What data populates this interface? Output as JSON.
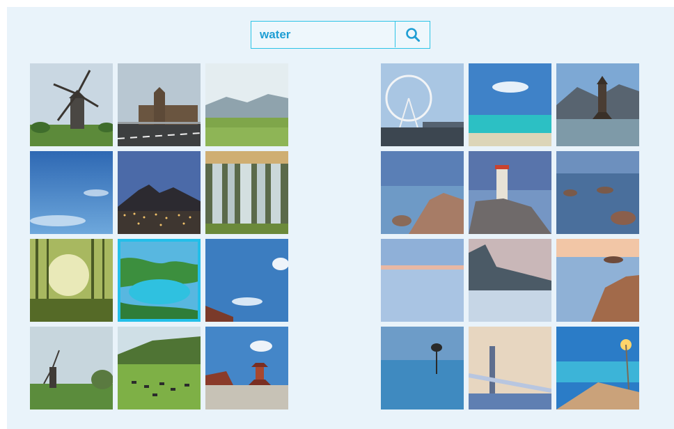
{
  "search": {
    "value": "water",
    "icon": "search-icon",
    "accent_color": "#2cc4e6",
    "text_color": "#1f9ed4"
  },
  "left_gallery": {
    "selected_index": 7,
    "tiles": [
      {
        "icon": "windmill-photo"
      },
      {
        "icon": "parliament-building-photo"
      },
      {
        "icon": "mountain-meadow-photo"
      },
      {
        "icon": "blue-sky-photo"
      },
      {
        "icon": "night-city-mountain-photo"
      },
      {
        "icon": "waterfall-photo"
      },
      {
        "icon": "sunlit-forest-photo"
      },
      {
        "icon": "tropical-lagoon-photo"
      },
      {
        "icon": "sky-with-rooftop-photo"
      },
      {
        "icon": "windmill-field-photo"
      },
      {
        "icon": "grazing-cows-hills-photo"
      },
      {
        "icon": "pagoda-temple-photo"
      }
    ]
  },
  "right_gallery": {
    "tiles": [
      {
        "icon": "ferris-wheel-photo"
      },
      {
        "icon": "turquoise-beach-photo"
      },
      {
        "icon": "lake-pagoda-photo"
      },
      {
        "icon": "rocky-shore-photo"
      },
      {
        "icon": "lighthouse-photo"
      },
      {
        "icon": "seaside-rocks-photo"
      },
      {
        "icon": "calm-sea-dusk-photo"
      },
      {
        "icon": "mountain-coast-dusk-photo"
      },
      {
        "icon": "boulders-by-sea-photo"
      },
      {
        "icon": "lone-tree-lake-photo"
      },
      {
        "icon": "bridge-sunset-photo"
      },
      {
        "icon": "coastal-road-night-photo"
      }
    ]
  }
}
